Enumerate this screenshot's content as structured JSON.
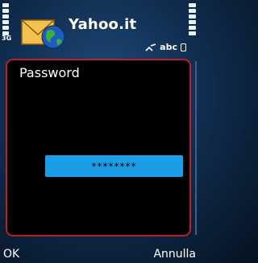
{
  "app": {
    "title": "Yahoo.it",
    "icon": "mail-globe-icon"
  },
  "status": {
    "network": "3G",
    "input_mode": "abc"
  },
  "dialog": {
    "label": "Password",
    "field_value": "********"
  },
  "softkeys": {
    "left": "OK",
    "right": "Annulla"
  },
  "colors": {
    "accent": "#1a9ee8",
    "dialog_border": "#b8202b",
    "dialog_bg": "#000000"
  }
}
